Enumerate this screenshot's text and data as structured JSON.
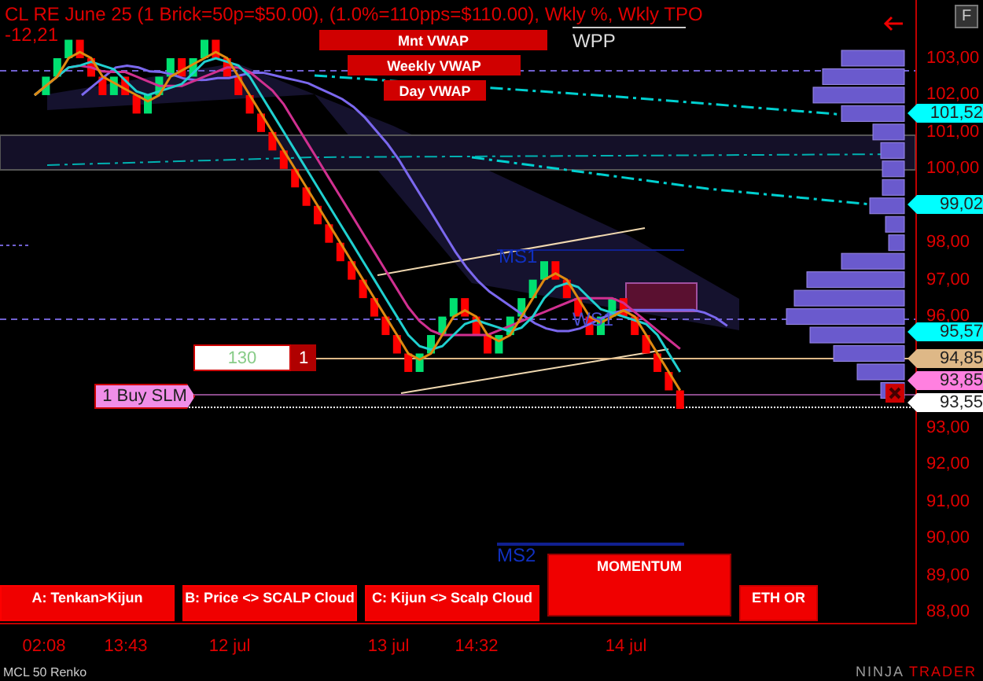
{
  "title": {
    "line_1": "CL RE June 25 (1 Brick=50p=$50.00), (1.0%=110pps=$110.00), Wkly %, Wkly TPO",
    "line_2": "-12,21"
  },
  "vwap_labels": [
    {
      "label": "Mnt VWAP"
    },
    {
      "label": "Weekly VWAP"
    },
    {
      "label": "Day VWAP"
    }
  ],
  "wpp_label": "WPP",
  "pivot_labels": [
    {
      "label": "MS1"
    },
    {
      "label": "WS1"
    },
    {
      "label": "MS2"
    }
  ],
  "f_button": "F",
  "price_axis": [
    "103,00",
    "102,00",
    "101,00",
    "100,00",
    "98,00",
    "97,00",
    "96,00",
    "93,00",
    "92,00",
    "91,00",
    "90,00",
    "89,00",
    "88,00"
  ],
  "price_tags": [
    {
      "value": "101,52",
      "color": "#00ffff"
    },
    {
      "value": "99,02",
      "color": "#00ffff"
    },
    {
      "value": "95,57",
      "color": "#00ffff"
    },
    {
      "value": "94,85",
      "color": "#deb887"
    },
    {
      "value": "93,85",
      "color": "#ff80e0"
    },
    {
      "value": "93,55",
      "color": "#ffffff"
    }
  ],
  "order": {
    "quantity": "130",
    "count": "1",
    "tag": "1 Buy SLM"
  },
  "signal_boxes": [
    {
      "label": "A: Tenkan>Kijun",
      "kind": "bar"
    },
    {
      "label": "B: Price <> SCALP Cloud",
      "kind": "bar"
    },
    {
      "label": "C: Kijun <> Scalp Cloud",
      "kind": "bar"
    },
    {
      "label": "MOMENTUM",
      "kind": "panel"
    },
    {
      "label": "ETH OR",
      "kind": "bar"
    }
  ],
  "time_axis": [
    "02:08",
    "13:43",
    "12 jul",
    "13 jul",
    "14:32",
    "14 jul"
  ],
  "footer": {
    "instrument": "MCL 50 Renko",
    "brand_left": "NINJA",
    "brand_right": "TRADER"
  }
}
